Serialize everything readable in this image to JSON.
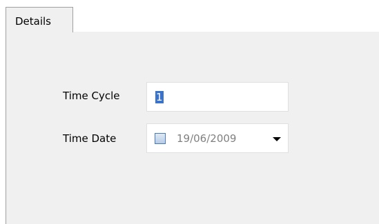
{
  "tabs": [
    {
      "label": "Details",
      "selected": true
    }
  ],
  "form": {
    "time_cycle": {
      "label": "Time Cycle",
      "value": "1"
    },
    "time_date": {
      "label": "Time Date",
      "value": "19/06/2009",
      "checked": false
    }
  },
  "icons": {
    "date_checkbox": "checkbox-unchecked-icon",
    "dropdown": "chevron-down-icon"
  },
  "colors": {
    "panel_background": "#f0f0f0",
    "selection_highlight": "#3a73c9",
    "disabled_text": "#808080"
  }
}
